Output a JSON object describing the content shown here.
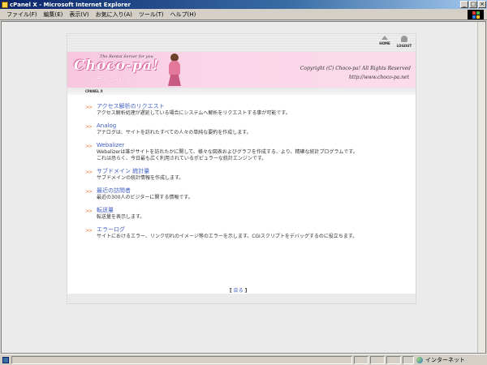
{
  "window": {
    "title": "cPanel X - Microsoft Internet Explorer",
    "min_glyph": "_",
    "max_glyph": "□",
    "close_glyph": "×"
  },
  "menu": [
    "ファイル(F)",
    "編集(E)",
    "表示(V)",
    "お気に入り(A)",
    "ツール(T)",
    "ヘルプ(H)"
  ],
  "nav": {
    "home": "HOME",
    "logout": "LOGOUT"
  },
  "banner": {
    "logo_sub": "The Rental Server for you",
    "logo": "Choco-pa!",
    "logo_jp": "チョコパ！",
    "copyright": "Copyright (C) Choco-pa! All Rights Reserved",
    "url": "http://www.choco-pa.net"
  },
  "crumb": "CPANEL X",
  "bullet": ">>",
  "items": [
    {
      "title": "アクセス解析のリクエスト",
      "desc": "アクセス解析処理が遅延している場合にシステムへ解析をリクエストする事が可能です。"
    },
    {
      "title": "Analog",
      "desc": "アナログは、サイトを訪れたすべての人々の単純な要約を作成します。"
    },
    {
      "title": "Webalizer",
      "desc": "Webalizerは誰がサイトを訪れたかに関して、様々な図表およびグラフを作成する、より、精確な統計プログラムです。",
      "desc2": "これは恐らく、今日最も広く利用されているポピュラーな統計エンジンです。"
    },
    {
      "title": "サブドメイン 統計量",
      "desc": "サブドメインの統計情報を作成します。"
    },
    {
      "title": "最近の訪問者",
      "desc": "最近の300人のビジターに関する情報です。"
    },
    {
      "title": "転送量",
      "desc": "転送量を表示します。"
    },
    {
      "title": "エラーログ",
      "desc": "サイトにおけるエラー、リンク切れのイメージ等のエラーを示します。CGIスクリプトをデバッグするのに役立ちます。"
    }
  ],
  "back": {
    "open": "[",
    "label": "戻る",
    "close": "]"
  },
  "status": {
    "zone": "インターネット"
  }
}
